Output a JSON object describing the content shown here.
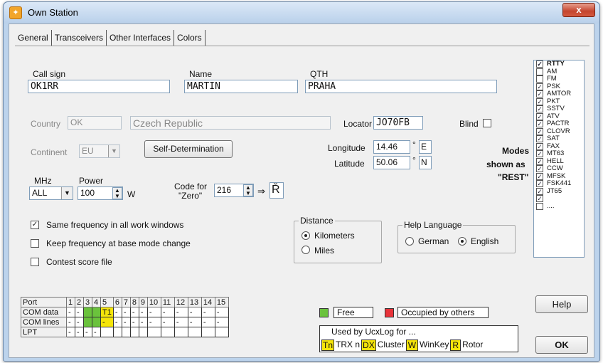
{
  "window": {
    "title": "Own Station",
    "close": "x"
  },
  "tabs": [
    "General",
    "Transceivers",
    "Other Interfaces",
    "Colors"
  ],
  "general": {
    "callsign_label": "Call sign",
    "callsign": "OK1RR",
    "name_label": "Name",
    "name": "MARTIN",
    "qth_label": "QTH",
    "qth": "PRAHA",
    "country_label": "Country",
    "country_code": "OK",
    "country_name": "Czech Republic",
    "locator_label": "Locator",
    "locator": "JO70FB",
    "blind_label": "Blind",
    "continent_label": "Continent",
    "continent": "EU",
    "self_determination": "Self-Determination",
    "longitude_label": "Longitude",
    "longitude": "14.46",
    "lon_dir": "E",
    "latitude_label": "Latitude",
    "latitude": "50.06",
    "lat_dir": "N",
    "degree": "°",
    "mhz_label": "MHz",
    "mhz": "ALL",
    "power_label": "Power",
    "power": "100",
    "power_unit": "W",
    "code_zero_label_1": "Code for",
    "code_zero_label_2": "\"Zero\"",
    "code_zero": "216",
    "arrow": "⇒",
    "zero_char": "Ř",
    "modes_note_1": "Modes",
    "modes_note_2": "shown as",
    "modes_note_3": "\"REST\"",
    "check_same_freq": "Same frequency in all work windows",
    "check_keep_freq": "Keep frequency at base mode change",
    "check_contest": "Contest score file",
    "distance_title": "Distance",
    "km": "Kilometers",
    "miles": "Miles",
    "help_lang_title": "Help Language",
    "german": "German",
    "english": "English"
  },
  "modes": [
    {
      "label": "RTTY",
      "checked": true
    },
    {
      "label": "AM",
      "checked": false
    },
    {
      "label": "FM",
      "checked": false
    },
    {
      "label": "PSK",
      "checked": true
    },
    {
      "label": "AMTOR",
      "checked": true
    },
    {
      "label": "PKT",
      "checked": true
    },
    {
      "label": "SSTV",
      "checked": true
    },
    {
      "label": "ATV",
      "checked": true
    },
    {
      "label": "PACTR",
      "checked": true
    },
    {
      "label": "CLOVR",
      "checked": true
    },
    {
      "label": "SAT",
      "checked": true
    },
    {
      "label": "FAX",
      "checked": true
    },
    {
      "label": "MT63",
      "checked": true
    },
    {
      "label": "HELL",
      "checked": true
    },
    {
      "label": "CCW",
      "checked": true
    },
    {
      "label": "MFSK",
      "checked": true
    },
    {
      "label": "FSK441",
      "checked": true
    },
    {
      "label": "JT65",
      "checked": true
    },
    {
      "label": "",
      "checked": true
    },
    {
      "label": "....",
      "checked": false
    }
  ],
  "ports": {
    "header": [
      "Port",
      "1",
      "2",
      "3",
      "4",
      "5",
      "6",
      "7",
      "8",
      "9",
      "10",
      "11",
      "12",
      "13",
      "14",
      "15"
    ],
    "rows": [
      {
        "label": "COM data",
        "cells": [
          "-",
          "-",
          "",
          "",
          "T1",
          "-",
          "-",
          "-",
          "-",
          "-",
          "-",
          "-",
          "-",
          "-",
          "-"
        ],
        "colors": [
          "",
          "",
          "green",
          "green",
          "yellow",
          "",
          "",
          "",
          "",
          "",
          "",
          "",
          "",
          "",
          ""
        ]
      },
      {
        "label": "COM lines",
        "cells": [
          "-",
          "-",
          "",
          "",
          "-",
          "-",
          "-",
          "-",
          "-",
          "-",
          "-",
          "-",
          "-",
          "-",
          "-"
        ],
        "colors": [
          "",
          "",
          "green",
          "green",
          "yellow",
          "",
          "",
          "",
          "",
          "",
          "",
          "",
          "",
          "",
          ""
        ]
      },
      {
        "label": "LPT",
        "cells": [
          "-",
          "-",
          "-",
          "-",
          "",
          "",
          "",
          "",
          "",
          "",
          "",
          "",
          "",
          "",
          ""
        ],
        "colors": [
          "",
          "",
          "",
          "",
          "",
          "",
          "",
          "",
          "",
          "",
          "",
          "",
          "",
          "",
          ""
        ]
      }
    ]
  },
  "legend": {
    "free": "Free",
    "occupied": "Occupied by others",
    "used_by": "Used by UcxLog for ...",
    "tn": "Tn",
    "trx": "TRX n",
    "dx": "DX",
    "cluster": "Cluster",
    "w": "W",
    "winkey": "WinKey",
    "r": "R",
    "rotor": "Rotor",
    "free_color": "#6ac23c",
    "occupied_color": "#e8333a",
    "used_color": "#f5e50a"
  },
  "buttons": {
    "help": "Help",
    "ok": "OK"
  }
}
